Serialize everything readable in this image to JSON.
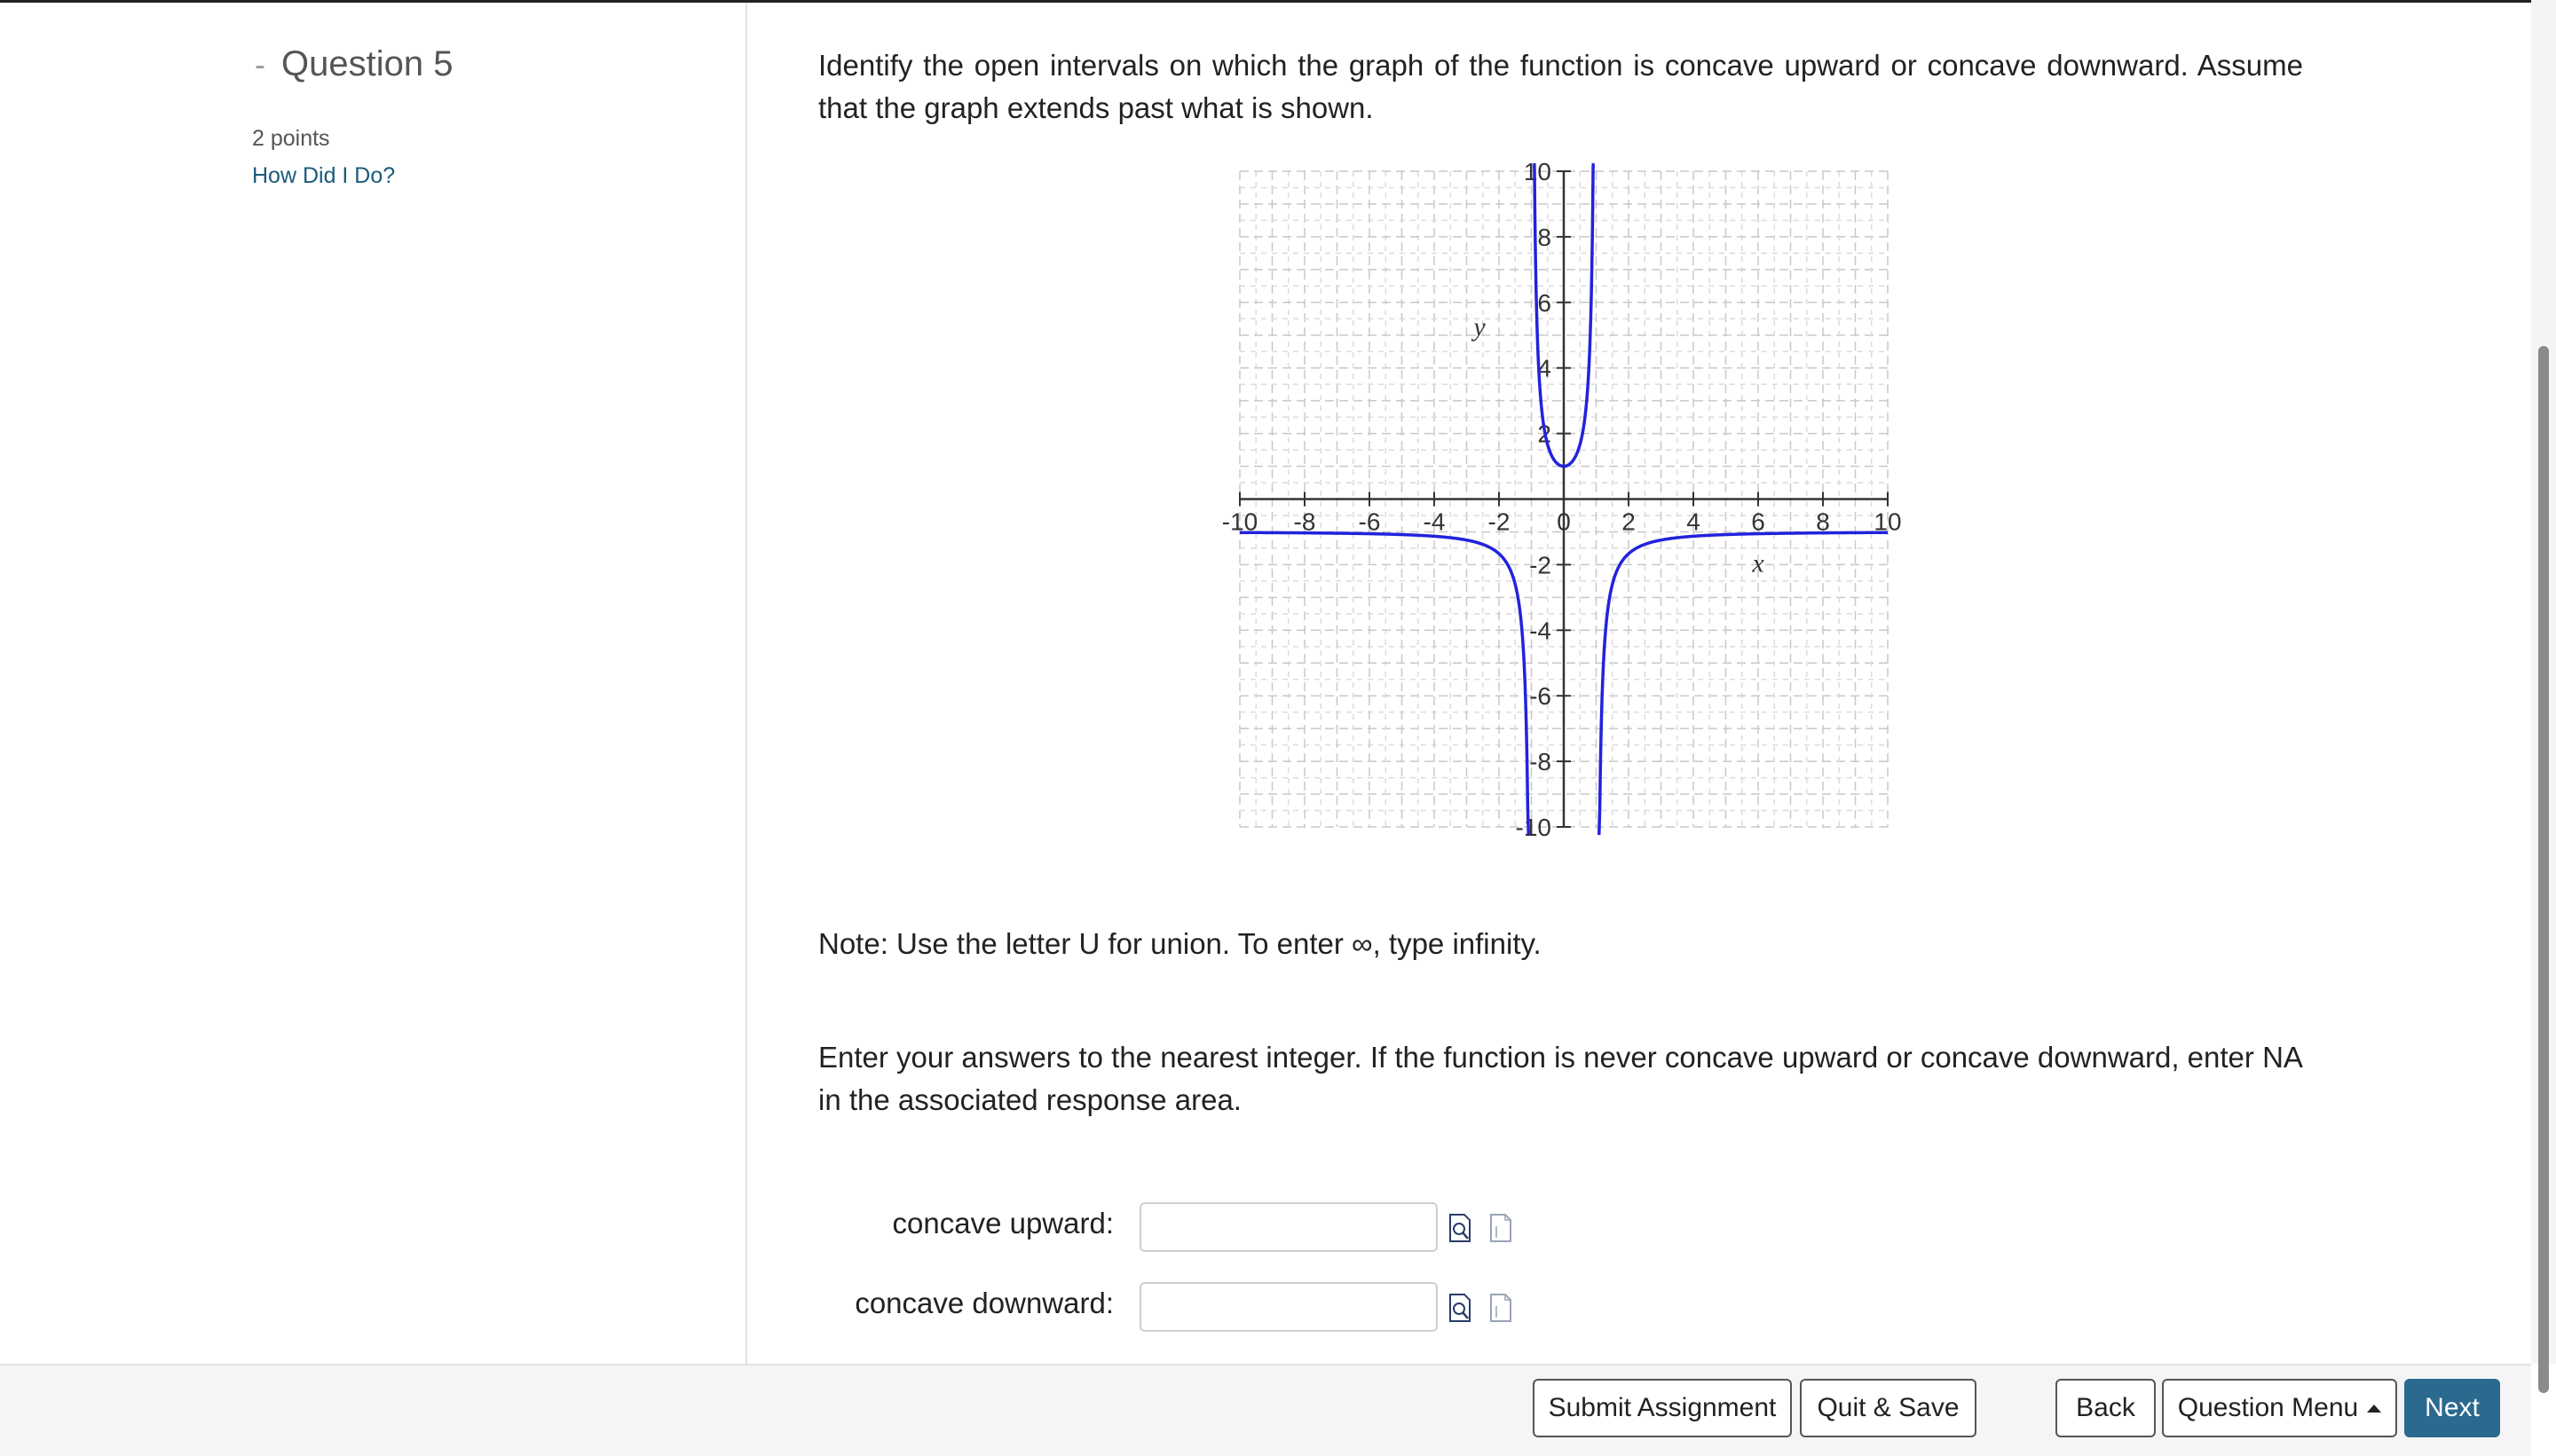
{
  "question": {
    "number_label": "Question 5",
    "points": "2 points",
    "help_link": "How Did I Do?"
  },
  "main": {
    "instruction": "Identify the open intervals on which the graph of the function is concave upward or concave downward. Assume that the graph extends past what is shown.",
    "note": "Note: Use the letter U for union. To enter ∞, type infinity.",
    "enter_note": "Enter your answers to the nearest integer. If the function is never concave upward or concave downward, enter NA in the associated response area."
  },
  "graph": {
    "xlabel": "x",
    "ylabel": "y",
    "x_ticks": [
      "-10",
      "-8",
      "-6",
      "-4",
      "-2",
      "0",
      "2",
      "4",
      "6",
      "8",
      "10"
    ],
    "y_ticks_pos": [
      "2",
      "4",
      "6",
      "8",
      "10"
    ],
    "y_ticks_neg": [
      "-2",
      "-4",
      "-6",
      "-8",
      "-10"
    ],
    "xlim": [
      -10,
      10
    ],
    "ylim": [
      -10,
      10
    ],
    "asymptotes": [
      -1,
      1
    ],
    "curve_color": "#2222dd"
  },
  "answers": {
    "up_label": "concave upward:",
    "down_label": "concave downward:",
    "up_value": "",
    "down_value": ""
  },
  "footer": {
    "submit": "Submit Assignment",
    "quit": "Quit & Save",
    "back": "Back",
    "menu": "Question Menu",
    "next": "Next"
  }
}
